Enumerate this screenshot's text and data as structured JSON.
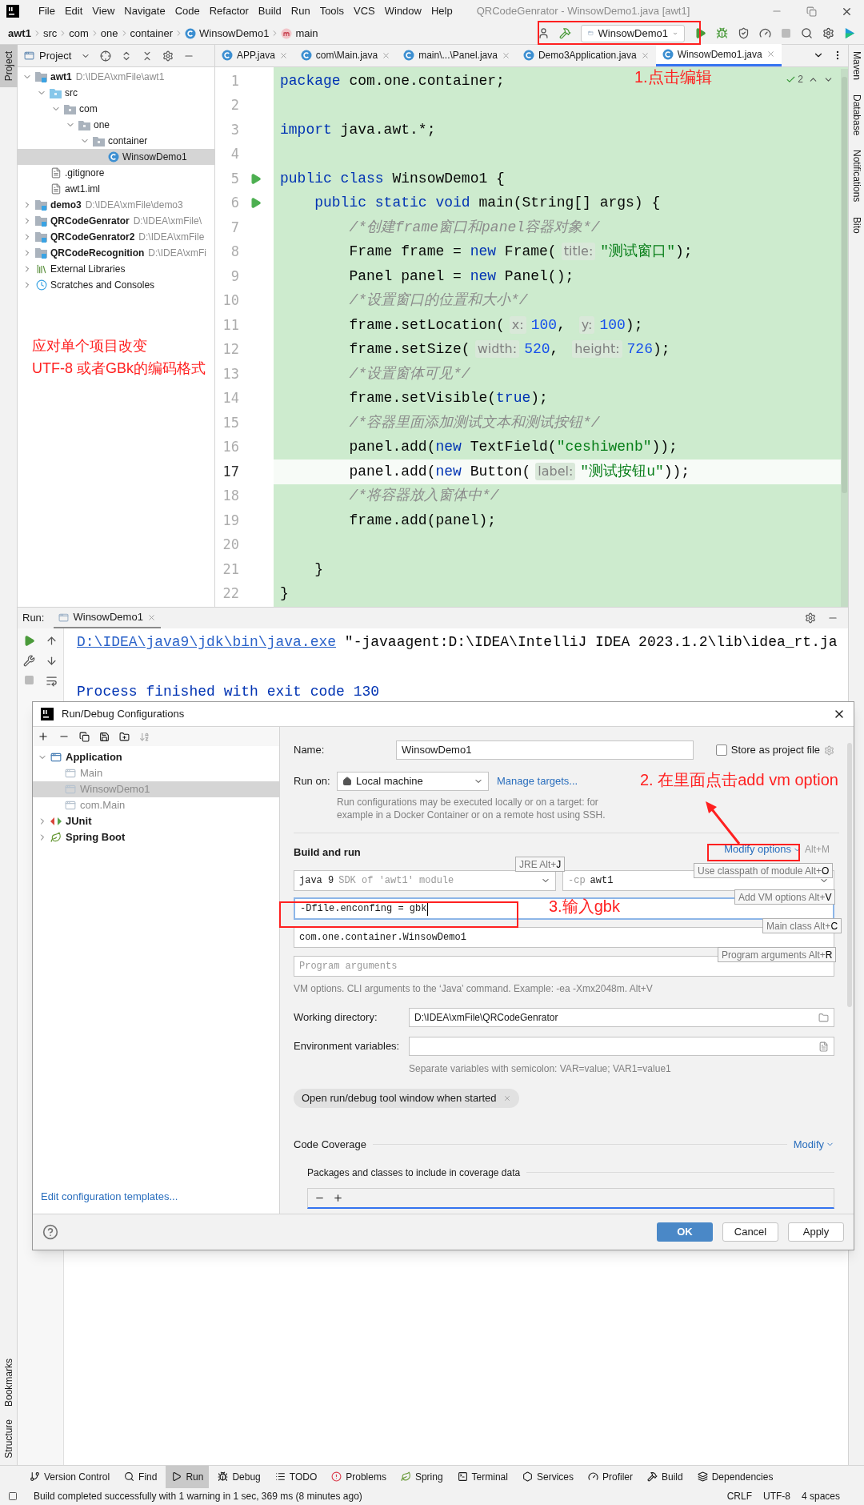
{
  "menu_bar": {
    "items": [
      "File",
      "Edit",
      "View",
      "Navigate",
      "Code",
      "Refactor",
      "Build",
      "Run",
      "Tools",
      "VCS",
      "Window",
      "Help"
    ],
    "title": "QRCodeGenrator - WinsowDemo1.java [awt1]"
  },
  "nav_bar": {
    "breadcrumbs": [
      {
        "label": "awt1",
        "kind": "module"
      },
      {
        "label": "src",
        "kind": "plain"
      },
      {
        "label": "com",
        "kind": "plain"
      },
      {
        "label": "one",
        "kind": "plain"
      },
      {
        "label": "container",
        "kind": "plain"
      },
      {
        "label": "WinsowDemo1",
        "kind": "class"
      },
      {
        "label": "main",
        "kind": "method"
      }
    ],
    "run_config": "WinsowDemo1"
  },
  "left_stripe": [
    {
      "label": "Project",
      "selected": true
    },
    {
      "label": "Bookmarks",
      "selected": false
    },
    {
      "label": "Structure",
      "selected": false
    }
  ],
  "right_stripe": [
    "Maven",
    "Database",
    "Notifications",
    "Bito"
  ],
  "project_panel": {
    "title": "Project",
    "tree": [
      {
        "label": "awt1",
        "path": "D:\\IDEA\\xmFile\\awt1",
        "kind": "module",
        "expanded": true,
        "selected": false,
        "children": [
          {
            "label": "src",
            "kind": "source",
            "expanded": true,
            "selected": false,
            "children": [
              {
                "label": "com",
                "kind": "package",
                "expanded": true,
                "selected": false,
                "children": [
                  {
                    "label": "one",
                    "kind": "package",
                    "expanded": true,
                    "selected": false,
                    "children": [
                      {
                        "label": "container",
                        "kind": "package",
                        "expanded": true,
                        "selected": false,
                        "children": [
                          {
                            "label": "WinsowDemo1",
                            "kind": "class",
                            "selected": true
                          }
                        ]
                      }
                    ]
                  }
                ]
              }
            ]
          },
          {
            "label": ".gitignore",
            "kind": "file",
            "selected": false
          },
          {
            "label": "awt1.iml",
            "kind": "file",
            "selected": false
          }
        ]
      },
      {
        "label": "demo3",
        "path": "D:\\IDEA\\xmFile\\demo3",
        "kind": "module",
        "expanded": false,
        "selected": false
      },
      {
        "label": "QRCodeGenrator",
        "path": "D:\\IDEA\\xmFile\\",
        "kind": "module",
        "expanded": false,
        "selected": false
      },
      {
        "label": "QRCodeGenrator2",
        "path": "D:\\IDEA\\xmFile",
        "kind": "module",
        "expanded": false,
        "selected": false
      },
      {
        "label": "QRCodeRecognition",
        "path": "D:\\IDEA\\xmFi",
        "kind": "module",
        "expanded": false,
        "selected": false
      },
      {
        "label": "External Libraries",
        "kind": "libraries",
        "expanded": false,
        "selected": false
      },
      {
        "label": "Scratches and Consoles",
        "kind": "scratches",
        "expanded": false,
        "selected": false
      }
    ]
  },
  "editor": {
    "tabs": [
      {
        "label": "APP.java",
        "selected": false
      },
      {
        "label": "com\\Main.java",
        "selected": false
      },
      {
        "label": "main\\...\\Panel.java",
        "selected": false
      },
      {
        "label": "Demo3Application.java",
        "selected": false
      },
      {
        "label": "WinsowDemo1.java",
        "selected": true
      }
    ],
    "inspection_count": "2",
    "lines": [
      {
        "number": "1",
        "run_marker": false,
        "current": false,
        "tokens": [
          {
            "kind": "kw",
            "t": "package"
          },
          {
            "kind": "plain",
            "t": " com.one.container;"
          }
        ]
      },
      {
        "number": "2",
        "run_marker": false,
        "current": false
      },
      {
        "number": "3",
        "run_marker": false,
        "current": false,
        "tokens": [
          {
            "kind": "kw",
            "t": "import"
          },
          {
            "kind": "plain",
            "t": " java.awt.*;"
          }
        ]
      },
      {
        "number": "4",
        "run_marker": false,
        "current": false
      },
      {
        "number": "5",
        "run_marker": true,
        "current": false,
        "tokens": [
          {
            "kind": "kw",
            "t": "public class"
          },
          {
            "kind": "plain",
            "t": " WinsowDemo1 {"
          }
        ]
      },
      {
        "number": "6",
        "run_marker": true,
        "current": false,
        "tokens": [
          {
            "kind": "kw",
            "t": "    public static void"
          },
          {
            "kind": "plain",
            "t": " main(String[] args) {"
          }
        ]
      },
      {
        "number": "7",
        "run_marker": false,
        "current": false,
        "tokens": [
          {
            "kind": "comment",
            "t": "        /*创建frame窗口和panel容器对象*/"
          }
        ]
      },
      {
        "number": "8",
        "run_marker": false,
        "current": false,
        "tokens": [
          {
            "kind": "plain",
            "t": "        Frame frame = "
          },
          {
            "kind": "kw",
            "t": "new"
          },
          {
            "kind": "plain",
            "t": " Frame("
          },
          {
            "kind": "hint",
            "t": "title:"
          },
          {
            "kind": "string",
            "t": "\"测试窗口\""
          },
          {
            "kind": "plain",
            "t": ");"
          }
        ]
      },
      {
        "number": "9",
        "run_marker": false,
        "current": false,
        "tokens": [
          {
            "kind": "plain",
            "t": "        Panel panel = "
          },
          {
            "kind": "kw",
            "t": "new"
          },
          {
            "kind": "plain",
            "t": " Panel();"
          }
        ]
      },
      {
        "number": "10",
        "run_marker": false,
        "current": false,
        "tokens": [
          {
            "kind": "comment",
            "t": "        /*设置窗口的位置和大小*/"
          }
        ]
      },
      {
        "number": "11",
        "run_marker": false,
        "current": false,
        "tokens": [
          {
            "kind": "plain",
            "t": "        frame.setLocation("
          },
          {
            "kind": "hint",
            "t": "x:"
          },
          {
            "kind": "number",
            "t": "100"
          },
          {
            "kind": "plain",
            "t": ", "
          },
          {
            "kind": "hint",
            "t": "y:"
          },
          {
            "kind": "number",
            "t": "100"
          },
          {
            "kind": "plain",
            "t": ");"
          }
        ]
      },
      {
        "number": "12",
        "run_marker": false,
        "current": false,
        "tokens": [
          {
            "kind": "plain",
            "t": "        frame.setSize("
          },
          {
            "kind": "hint",
            "t": "width:"
          },
          {
            "kind": "number",
            "t": "520"
          },
          {
            "kind": "plain",
            "t": ", "
          },
          {
            "kind": "hint",
            "t": "height:"
          },
          {
            "kind": "number",
            "t": "726"
          },
          {
            "kind": "plain",
            "t": ");"
          }
        ]
      },
      {
        "number": "13",
        "run_marker": false,
        "current": false,
        "tokens": [
          {
            "kind": "comment",
            "t": "        /*设置窗体可见*/"
          }
        ]
      },
      {
        "number": "14",
        "run_marker": false,
        "current": false,
        "tokens": [
          {
            "kind": "plain",
            "t": "        frame.setVisible("
          },
          {
            "kind": "kw",
            "t": "true"
          },
          {
            "kind": "plain",
            "t": ");"
          }
        ]
      },
      {
        "number": "15",
        "run_marker": false,
        "current": false,
        "tokens": [
          {
            "kind": "comment",
            "t": "        /*容器里面添加测试文本和测试按钮*/"
          }
        ]
      },
      {
        "number": "16",
        "run_marker": false,
        "current": false,
        "tokens": [
          {
            "kind": "plain",
            "t": "        panel.add("
          },
          {
            "kind": "kw",
            "t": "new"
          },
          {
            "kind": "plain",
            "t": " TextField("
          },
          {
            "kind": "string",
            "t": "\"ceshiwenb\""
          },
          {
            "kind": "plain",
            "t": "));"
          }
        ]
      },
      {
        "number": "17",
        "run_marker": false,
        "current": true,
        "tokens": [
          {
            "kind": "plain",
            "t": "        panel.add("
          },
          {
            "kind": "kw",
            "t": "new"
          },
          {
            "kind": "plain",
            "t": " Button("
          },
          {
            "kind": "hint",
            "t": "label:"
          },
          {
            "kind": "string",
            "t": "\"测试按钮u\""
          },
          {
            "kind": "plain",
            "t": "));"
          }
        ]
      },
      {
        "number": "18",
        "run_marker": false,
        "current": false,
        "tokens": [
          {
            "kind": "comment",
            "t": "        /*将容器放入窗体中*/"
          }
        ]
      },
      {
        "number": "19",
        "run_marker": false,
        "current": false,
        "tokens": [
          {
            "kind": "plain",
            "t": "        frame.add(panel);"
          }
        ]
      },
      {
        "number": "20",
        "run_marker": false,
        "current": false
      },
      {
        "number": "21",
        "run_marker": false,
        "current": false,
        "tokens": [
          {
            "kind": "plain",
            "t": "    }"
          }
        ]
      },
      {
        "number": "22",
        "run_marker": false,
        "current": false,
        "tokens": [
          {
            "kind": "plain",
            "t": "}"
          }
        ]
      }
    ]
  },
  "run_panel": {
    "label": "Run:",
    "tab": "WinsowDemo1",
    "console": [
      {
        "kind": "command",
        "link": "D:\\IDEA\\java9\\jdk\\bin\\java.exe",
        "text": " \"-javaagent:D:\\IDEA\\IntelliJ IDEA 2023.1.2\\lib\\idea_rt.ja"
      },
      {
        "kind": "output",
        "text": "Process finished with exit code 130"
      }
    ]
  },
  "dialog": {
    "title": "Run/Debug Configurations",
    "tree": [
      {
        "label": "Application",
        "kind": "group",
        "expanded": true,
        "selected": false,
        "children": [
          {
            "label": "Main",
            "kind": "config",
            "selected": false
          },
          {
            "label": "WinsowDemo1",
            "kind": "config",
            "selected": true
          },
          {
            "label": "com.Main",
            "kind": "config",
            "selected": false
          }
        ]
      },
      {
        "label": "JUnit",
        "kind": "junit",
        "expanded": false,
        "selected": false
      },
      {
        "label": "Spring Boot",
        "kind": "spring",
        "expanded": false,
        "selected": false
      }
    ],
    "templates_link": "Edit configuration templates...",
    "name": {
      "label": "Name:",
      "value": "WinsowDemo1"
    },
    "store_as_project_file": {
      "label": "Store as project file",
      "checked": false
    },
    "run_on": {
      "label": "Run on:",
      "value": "Local machine",
      "link": "Manage targets..."
    },
    "run_on_note": "Run configurations may be executed locally or on a target: for example in a Docker Container or on a remote host using SSH.",
    "build_and_run": {
      "title": "Build and run",
      "modify_link": "Modify options",
      "modify_shortcut": "Alt+M",
      "jre": {
        "value": "java 9",
        "hint": "SDK of 'awt1' module"
      },
      "classpath": {
        "prefix": "-cp",
        "value": "awt1"
      },
      "vm_options": "-Dfile.enconfing = gbk",
      "main_class": "com.one.container.WinsowDemo1",
      "program_arguments_placeholder": "Program arguments",
      "help": "VM options. CLI arguments to the ‘Java’ command. Example: -ea -Xmx2048m. Alt+V"
    },
    "shortcut_hints": [
      {
        "label": "JRE Alt+",
        "key": "J"
      },
      {
        "label": "Use classpath of module Alt+",
        "key": "O"
      },
      {
        "label": "Add VM options Alt+",
        "key": "V"
      },
      {
        "label": "Main class Alt+",
        "key": "C"
      },
      {
        "label": "Program arguments Alt+",
        "key": "R"
      }
    ],
    "working_directory": {
      "label": "Working directory:",
      "value": "D:\\IDEA\\xmFile\\QRCodeGenrator"
    },
    "environment_variables": {
      "label": "Environment variables:",
      "note": "Separate variables with semicolon: VAR=value; VAR1=value1"
    },
    "chip": "Open run/debug tool window when started",
    "code_coverage": {
      "title": "Code Coverage",
      "modify_link": "Modify",
      "packages_label": "Packages and classes to include in coverage data"
    },
    "buttons": [
      {
        "label": "OK",
        "kind": "primary"
      },
      {
        "label": "Cancel",
        "kind": "default"
      },
      {
        "label": "Apply",
        "kind": "default"
      }
    ]
  },
  "annotations": [
    {
      "kind": "label",
      "lines": [
        "1.点击编辑"
      ]
    },
    {
      "kind": "frame"
    },
    {
      "kind": "label",
      "lines": [
        "应对单个项目改变",
        "UTF-8 或者GBk的编码格式"
      ]
    },
    {
      "kind": "label",
      "lines": [
        "2. 在里面点击add vm option"
      ]
    },
    {
      "kind": "arrow"
    },
    {
      "kind": "frame"
    },
    {
      "kind": "frame"
    },
    {
      "kind": "label",
      "lines": [
        "3.输入gbk"
      ]
    }
  ],
  "tool_strip": [
    {
      "label": "Version Control",
      "kind": "branch",
      "selected": false
    },
    {
      "label": "Find",
      "kind": "find",
      "selected": false
    },
    {
      "label": "Run",
      "kind": "run",
      "selected": true
    },
    {
      "label": "Debug",
      "kind": "debug",
      "selected": false
    },
    {
      "label": "TODO",
      "kind": "todo",
      "selected": false
    },
    {
      "label": "Problems",
      "kind": "problems",
      "selected": false
    },
    {
      "label": "Spring",
      "kind": "spring",
      "selected": false
    },
    {
      "label": "Terminal",
      "kind": "terminal",
      "selected": false
    },
    {
      "label": "Services",
      "kind": "services",
      "selected": false
    },
    {
      "label": "Profiler",
      "kind": "profiler",
      "selected": false
    },
    {
      "label": "Build",
      "kind": "build",
      "selected": false
    },
    {
      "label": "Dependencies",
      "kind": "dependencies",
      "selected": false
    }
  ],
  "status_bar": {
    "message": "Build completed successfully with 1 warning in 1 sec, 369 ms (8 minutes ago)",
    "items": [
      "CRLF",
      "UTF-8",
      "4 spaces"
    ]
  }
}
